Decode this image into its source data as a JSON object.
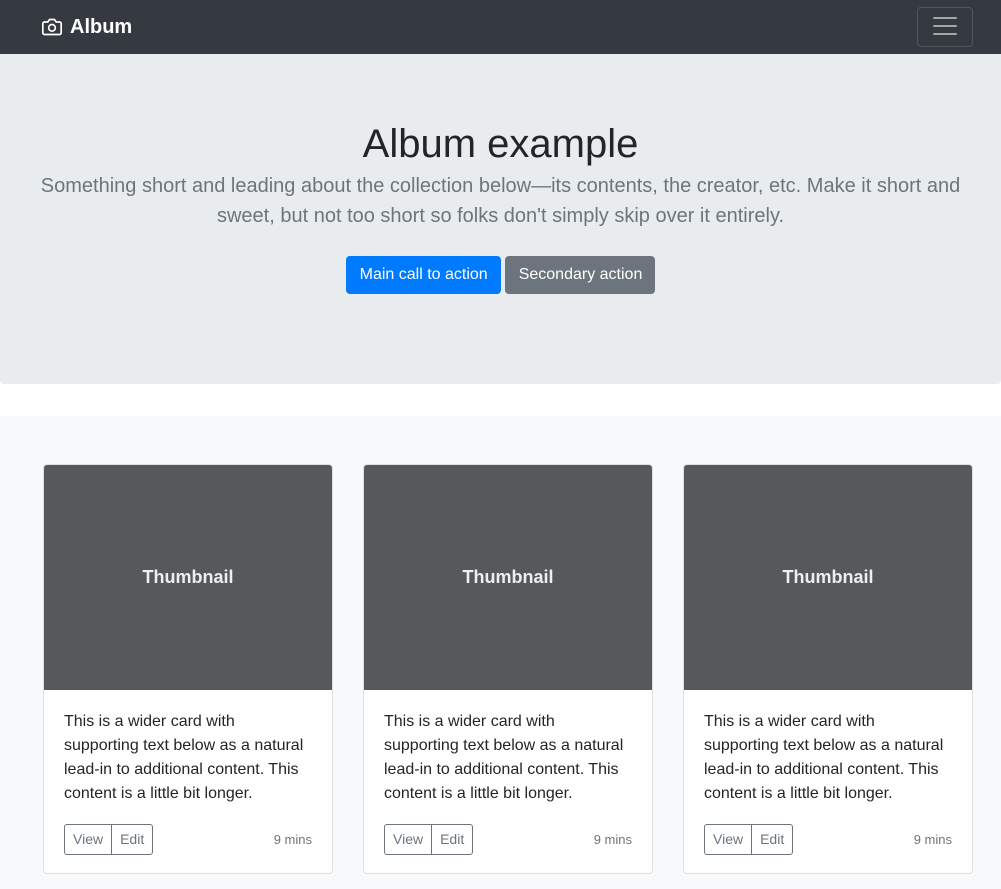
{
  "navbar": {
    "brand_label": "Album",
    "brand_icon": "camera-icon",
    "toggler_icon": "hamburger-icon"
  },
  "hero": {
    "title": "Album example",
    "lead": "Something short and leading about the collection below—its contents, the creator, etc. Make it short and sweet, but not too short so folks don't simply skip over it entirely.",
    "primary_label": "Main call to action",
    "secondary_label": "Secondary action"
  },
  "cards": [
    {
      "thumb_label": "Thumbnail",
      "text": "This is a wider card with supporting text below as a natural lead-in to additional content. This content is a little bit longer.",
      "view_label": "View",
      "edit_label": "Edit",
      "time": "9 mins"
    },
    {
      "thumb_label": "Thumbnail",
      "text": "This is a wider card with supporting text below as a natural lead-in to additional content. This content is a little bit longer.",
      "view_label": "View",
      "edit_label": "Edit",
      "time": "9 mins"
    },
    {
      "thumb_label": "Thumbnail",
      "text": "This is a wider card with supporting text below as a natural lead-in to additional content. This content is a little bit longer.",
      "view_label": "View",
      "edit_label": "Edit",
      "time": "9 mins"
    }
  ],
  "colors": {
    "navbar_bg": "#343a40",
    "jumbotron_bg": "#e9ecef",
    "primary": "#007bff",
    "secondary": "#6c757d",
    "thumbnail_bg": "#55595c",
    "album_bg": "#f8f9fa"
  }
}
